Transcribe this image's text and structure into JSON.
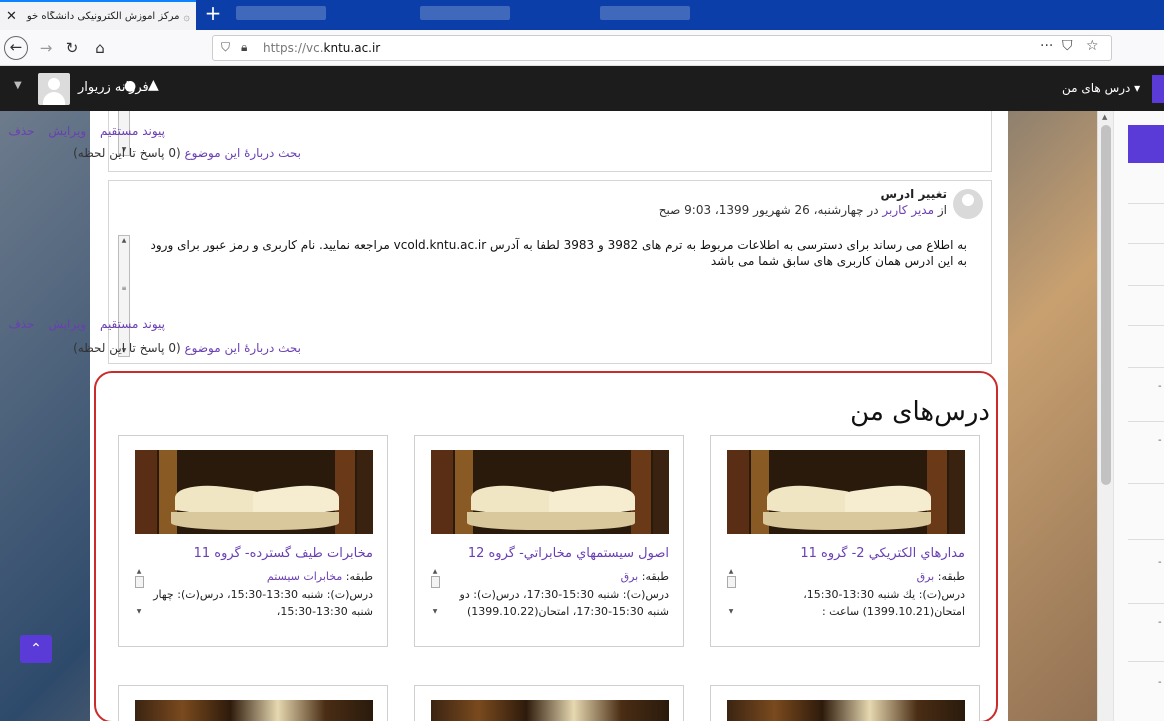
{
  "browser": {
    "tab_title": "مرکز آموزش الکترونیکی دانشگاه خو",
    "url_prefix": "https://vc.",
    "url_domain": "kntu.ac.ir",
    "menu_glyph": "···"
  },
  "header": {
    "username": "فرزانه زریوار",
    "my_courses_label": "درس های من ▾"
  },
  "post1": {
    "actions": [
      "حذف",
      "ویرایش",
      "پیوند مستقیم"
    ],
    "discuss_link": "بحث دربارهٔ این موضوع",
    "discuss_count": "(0 پاسخ تا این لحظه)"
  },
  "post2": {
    "title": "تغییر ادرس",
    "author_prefix": "از",
    "author": "مدیر کاربر",
    "date": "در چهارشنبه، 26 شهریور 1399، 9:03 صبح",
    "body": "به اطلاع می رساند برای دسترسی به اطلاعات مربوط به ترم های 3982 و 3983 لطفا به آدرس vcold.kntu.ac.ir  مراجعه نمایید. نام کاربری و رمز عبور برای ورود به این ادرس همان کاربری های سابق شما می باشد",
    "actions": [
      "حذف",
      "ویرایش",
      "پیوند مستقیم"
    ],
    "discuss_link": "بحث دربارهٔ این موضوع",
    "discuss_count": "(0 پاسخ تا این لحظه)"
  },
  "my_courses": {
    "title": "درس‌های من",
    "category_label": "طبقه:",
    "courses": [
      {
        "name": "مدارهاي الكتريكي 2- گروه 11",
        "category": "برق",
        "info": "درس(ت): يك شنبه 13:30-15:30، امتحان(1399.10.21) ساعت :"
      },
      {
        "name": "اصول سيستمهاي مخابراتي- گروه 12",
        "category": "برق",
        "info": "درس(ت): شنبه 15:30-17:30، درس(ت): دو شنبه 15:30-17:30، امتحان(1399.10.22)"
      },
      {
        "name": "مخابرات طيف گسترده- گروه 11",
        "category": "مخابرات سيستم",
        "info": "درس(ت): شنبه 13:30-15:30، درس(ت): چهار شنبه 13:30-15:30،"
      }
    ]
  },
  "colors": {
    "accent": "#5b3bd8",
    "link": "#6a3fb3",
    "highlight_border": "#cc2b2b",
    "header_bg": "#1c1c1c"
  }
}
